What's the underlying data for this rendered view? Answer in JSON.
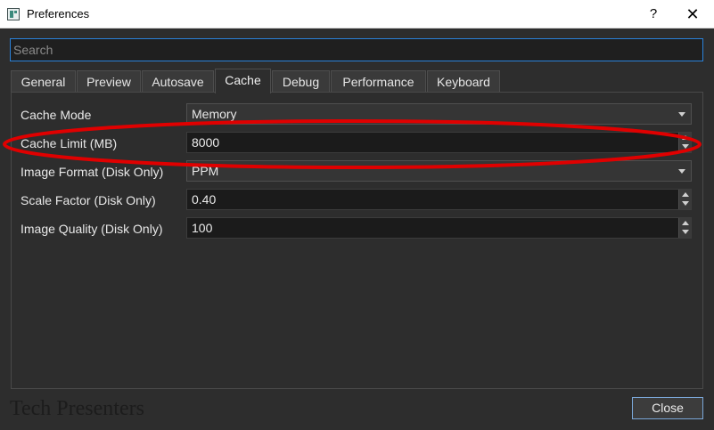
{
  "window": {
    "title": "Preferences",
    "help_label": "?",
    "close_label": "✕"
  },
  "search": {
    "placeholder": "Search"
  },
  "tabs": [
    {
      "label": "General"
    },
    {
      "label": "Preview"
    },
    {
      "label": "Autosave"
    },
    {
      "label": "Cache",
      "active": true
    },
    {
      "label": "Debug"
    },
    {
      "label": "Performance"
    },
    {
      "label": "Keyboard"
    }
  ],
  "cache": {
    "mode": {
      "label": "Cache Mode",
      "value": "Memory"
    },
    "limit": {
      "label": "Cache Limit (MB)",
      "value": "8000"
    },
    "image_format": {
      "label": "Image Format (Disk Only)",
      "value": "PPM"
    },
    "scale_factor": {
      "label": "Scale Factor (Disk Only)",
      "value": "0.40"
    },
    "image_quality": {
      "label": "Image Quality (Disk Only)",
      "value": "100"
    }
  },
  "footer": {
    "watermark": "Tech Presenters",
    "close_button": "Close"
  },
  "colors": {
    "background": "#2d2d2d",
    "accent": "#2a82da",
    "annotation": "#e00000"
  }
}
